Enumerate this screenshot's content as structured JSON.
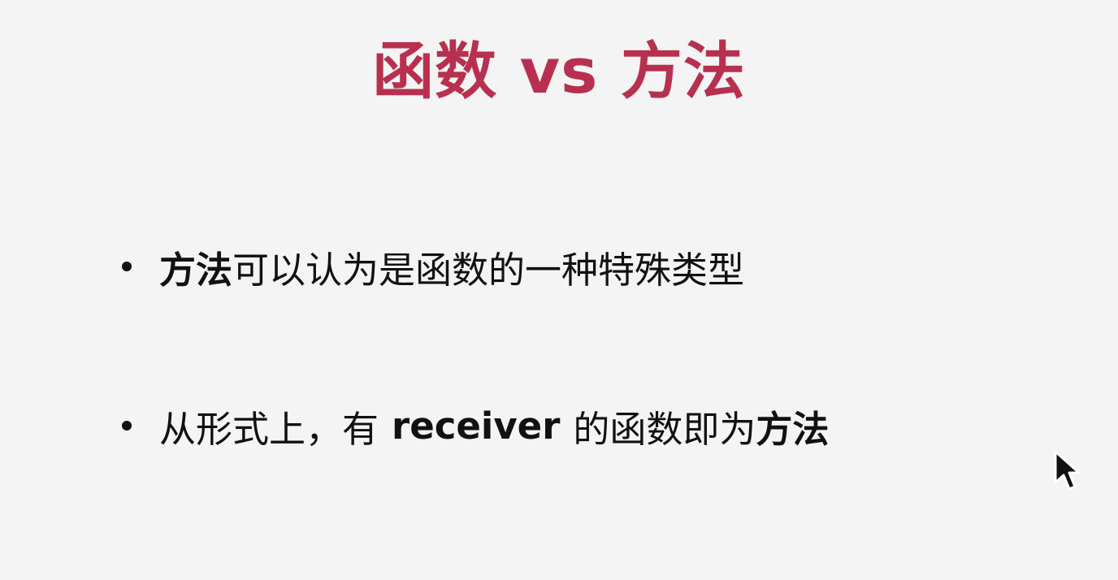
{
  "slide": {
    "title": "函数 vs 方法",
    "title_color": "#b8304f",
    "bullets": [
      {
        "strong": "方法",
        "text": "可以认为是函数的一种特殊类型"
      },
      {
        "prefix": "从形式上，有",
        "strong_mid": "receiver",
        "middle": "的函数即为",
        "strong_end": "方法"
      }
    ]
  },
  "cursor": {
    "icon": "arrow-pointer"
  }
}
